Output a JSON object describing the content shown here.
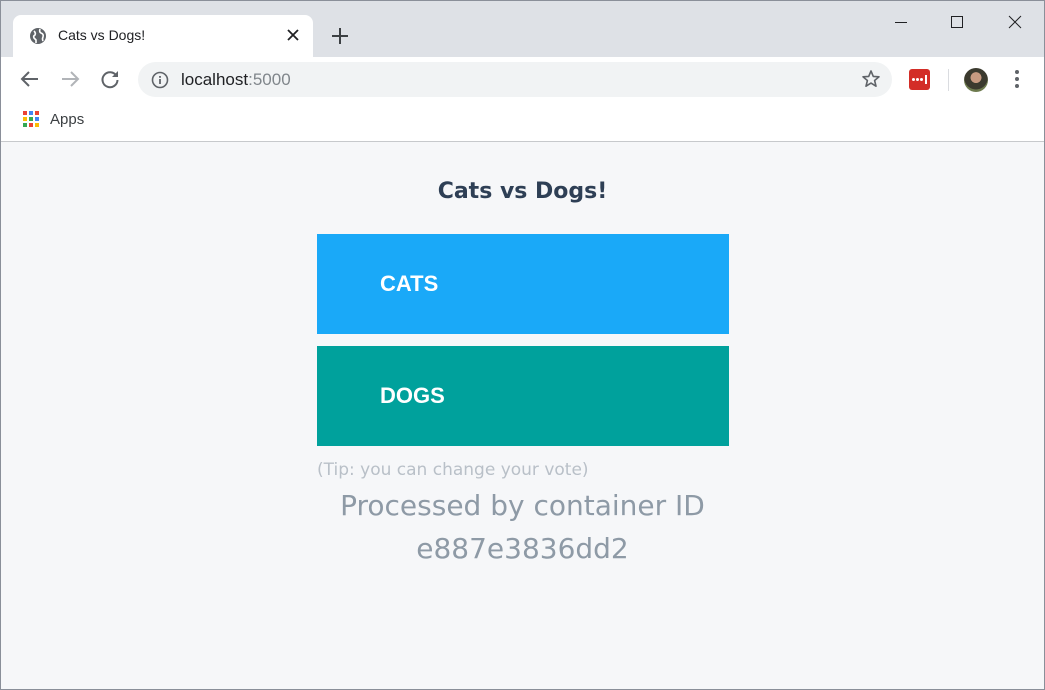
{
  "browser": {
    "tab_title": "Cats vs Dogs!",
    "url_host": "localhost",
    "url_port": ":5000",
    "bookmarks": {
      "apps_label": "Apps"
    },
    "icons": {
      "favicon": "globe-icon",
      "tab_close": "close-icon",
      "new_tab": "plus-icon",
      "back": "arrow-left-icon",
      "forward": "arrow-right-icon",
      "reload": "reload-icon",
      "site_info": "info-icon",
      "bookmark_star": "star-icon",
      "extension": "lastpass-icon",
      "menu": "kebab-menu-icon"
    }
  },
  "page": {
    "title": "Cats vs Dogs!",
    "options": [
      {
        "label": "CATS",
        "color": "#1aa9f8"
      },
      {
        "label": "DOGS",
        "color": "#00a19c"
      }
    ],
    "tip": "(Tip: you can change your vote)",
    "processed_line1": "Processed by container ID",
    "processed_line2": "e887e3836dd2"
  }
}
